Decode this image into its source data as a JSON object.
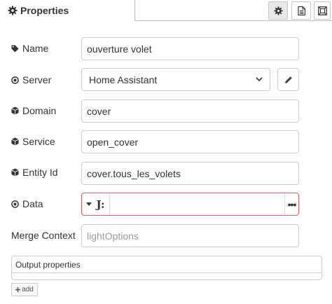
{
  "header": {
    "title": "Properties",
    "toolbar": [
      {
        "name": "settings-tab-button",
        "icon": "gear-icon",
        "selected": true
      },
      {
        "name": "description-tab-button",
        "icon": "document-icon",
        "selected": false
      },
      {
        "name": "appearance-tab-button",
        "icon": "frame-icon",
        "selected": false
      }
    ]
  },
  "form": {
    "name": {
      "label": "Name",
      "icon": "tag-icon",
      "value": "ouverture volet"
    },
    "server": {
      "label": "Server",
      "icon": "dot-circle-icon",
      "value": "Home Assistant"
    },
    "domain": {
      "label": "Domain",
      "icon": "cube-icon",
      "value": "cover"
    },
    "service": {
      "label": "Service",
      "icon": "cube-icon",
      "value": "open_cover"
    },
    "entity": {
      "label": "Entity Id",
      "icon": "cube-icon",
      "value": "cover.tous_les_volets"
    },
    "data": {
      "label": "Data",
      "icon": "dot-circle-icon",
      "type_label": "J:",
      "value": "",
      "expand_label": "•••"
    },
    "merge": {
      "label": "Merge Context",
      "value": "",
      "placeholder": "lightOptions"
    }
  },
  "output": {
    "header": "Output properties",
    "add_label": "add"
  },
  "colors": {
    "error_border": "#d6615f",
    "border": "#cccccc",
    "toolbar_selected": "#e8e8e8"
  }
}
